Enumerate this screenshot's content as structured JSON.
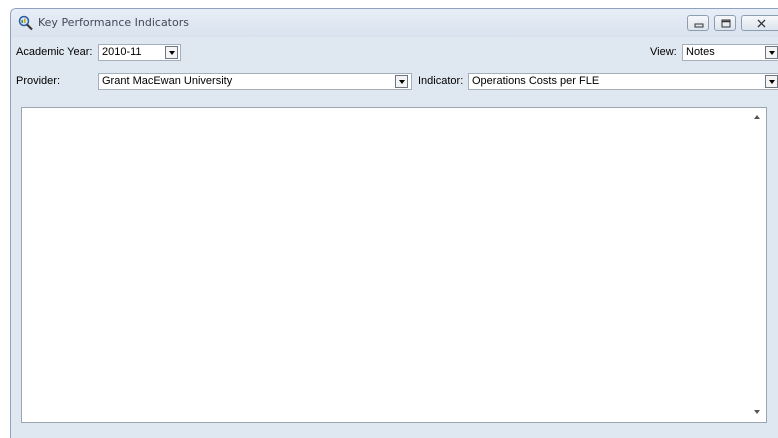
{
  "window": {
    "title": "Key Performance Indicators",
    "app_icon": "magnifier-chart-icon",
    "controls": [
      "minimize-icon",
      "restore-icon",
      "close-icon"
    ]
  },
  "filters": {
    "academic_year_label": "Academic Year:",
    "academic_year_value": "2010-11",
    "view_label": "View:",
    "view_value": "Notes",
    "provider_label": "Provider:",
    "provider_value": "Grant MacEwan University",
    "indicator_label": "Indicator:",
    "indicator_value": "Operations Costs per FLE"
  },
  "notes": {
    "content": ""
  }
}
